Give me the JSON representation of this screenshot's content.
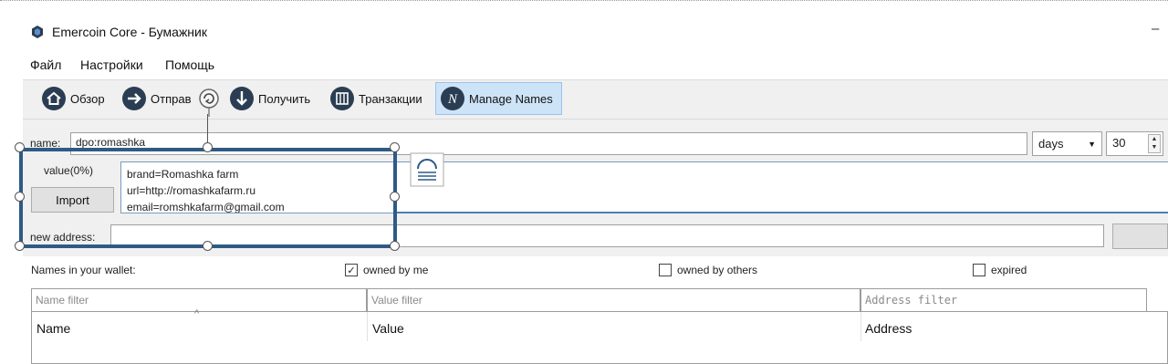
{
  "window": {
    "title": "Emercoin Core - Бумажник",
    "minimize_glyph": "–"
  },
  "menu": [
    "Файл",
    "Настройки",
    "Помощь"
  ],
  "toolbar": {
    "overview": "Обзор",
    "send": "Отправ",
    "receive": "Получить",
    "transactions": "Транзакции",
    "manage_names": "Manage Names"
  },
  "form": {
    "name_label": "name:",
    "name_value": "dpo:romashka",
    "days_option": "days",
    "days_count": "30",
    "value_label": "value(0%)",
    "import_button": "Import",
    "value_lines": [
      "brand=Romashka farm",
      "url=http://romashkafarm.ru",
      "email=romshkafarm@gmail.com"
    ],
    "new_address_label": "new address:"
  },
  "wallet": {
    "names_label": "Names in your wallet:",
    "owned_by_me": "owned by me",
    "owned_by_me_checked": true,
    "owned_by_others": "owned by others",
    "owned_by_others_checked": false,
    "expired": "expired",
    "expired_checked": false
  },
  "filters": {
    "name_placeholder": "Name filter",
    "value_placeholder": "Value filter",
    "address_placeholder": "Address filter"
  },
  "table": {
    "columns": [
      "Name",
      "Value",
      "Address"
    ]
  },
  "icons": {
    "app": "emercoin-logo-icon",
    "overview": "home-icon",
    "send": "send-arrow-icon",
    "receive": "receive-arrow-icon",
    "transactions": "transactions-icon",
    "manage_names": "names-icon"
  },
  "colors": {
    "accent": "#2f5a86",
    "active_tab": "#cde3f7",
    "icon_dark": "#2b3d52"
  }
}
